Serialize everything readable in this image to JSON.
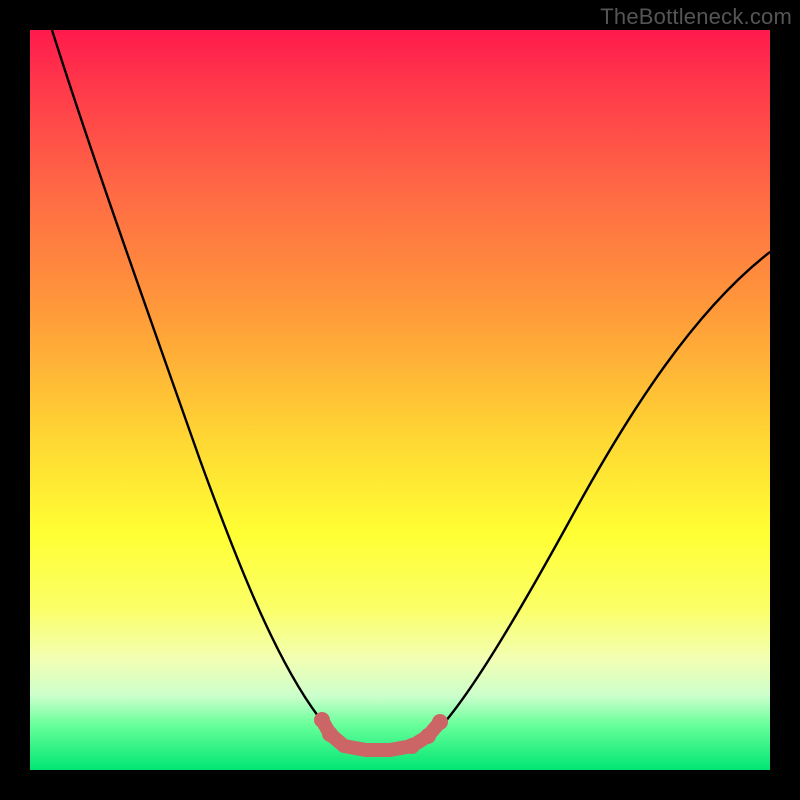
{
  "watermark": "TheBottleneck.com",
  "chart_data": {
    "type": "line",
    "title": "",
    "xlabel": "",
    "ylabel": "",
    "xlim": [
      0,
      1
    ],
    "ylim": [
      0,
      1
    ],
    "curve_main": {
      "name": "bottleneck-curve",
      "color": "#000000",
      "x": [
        0.03,
        0.08,
        0.13,
        0.18,
        0.23,
        0.28,
        0.33,
        0.37,
        0.4,
        0.43,
        0.47,
        0.5,
        0.53,
        0.57,
        0.62,
        0.68,
        0.75,
        0.82,
        0.9,
        0.98
      ],
      "y": [
        1.0,
        0.86,
        0.73,
        0.6,
        0.47,
        0.35,
        0.24,
        0.15,
        0.09,
        0.05,
        0.04,
        0.04,
        0.05,
        0.09,
        0.17,
        0.27,
        0.38,
        0.49,
        0.6,
        0.7
      ]
    },
    "highlight_segment": {
      "name": "valley-highlight",
      "color": "#cc6666",
      "x": [
        0.4,
        0.43,
        0.47,
        0.5,
        0.53,
        0.55
      ],
      "y": [
        0.09,
        0.05,
        0.04,
        0.04,
        0.05,
        0.07
      ]
    },
    "background_gradient": {
      "top_color": "#ff1a4d",
      "mid_color": "#ffff33",
      "bottom_color": "#00e673"
    }
  }
}
